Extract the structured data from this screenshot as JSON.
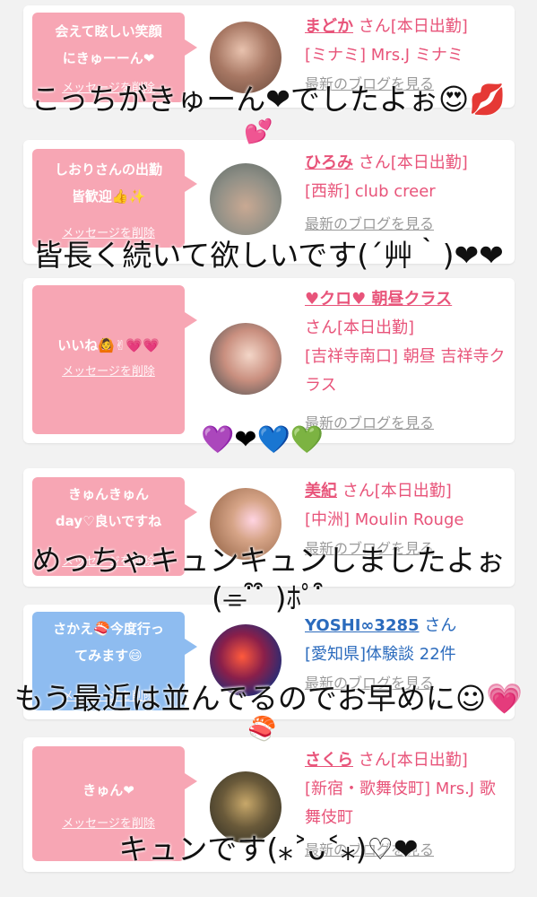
{
  "delete_label": "メッセージを削除",
  "blog_label": "最新のブログを見る",
  "honorific": "さん",
  "cards": [
    {
      "message": "会えて眩しい笑顔\nにきゅーーん❤",
      "name": "まどか",
      "status": "[本日出勤]",
      "shop": "[ミナミ] Mrs.J ミナミ"
    },
    {
      "message": "しおりさんの出勤\n皆歓迎👍✨",
      "name": "ひろみ",
      "status": "[本日出勤]",
      "shop": "[西新] club creer"
    },
    {
      "message": "いいね🙆✌💗💗",
      "name": "♥クロ♥ 朝昼クラス",
      "status": "[本日出勤]",
      "shop": "[吉祥寺南口] 朝昼 吉祥寺クラス"
    },
    {
      "message": "きゅんきゅん\nday♡良いですね",
      "name": "美紀",
      "status": "[本日出勤]",
      "shop": "[中洲] Moulin Rouge"
    },
    {
      "message": "さかえ🍣今度行っ\nてみます😄",
      "name": "YOSHI∞3285",
      "status": "",
      "shop": "[愛知県]体験談 22件"
    },
    {
      "message": "きゅん❤",
      "name": "さくら",
      "status": "[本日出勤]",
      "shop": "[新宿・歌舞伎町] Mrs.J 歌舞伎町"
    }
  ],
  "captions": {
    "c1": "こっちがきゅーん❤でしたよぉ😍💋",
    "c2": "皆長く続いて欲しいです(´艸｀)❤❤",
    "c3": "めっちゃキュンキュンしましたよぉ",
    "c4": "(⌯ ͒ ͒ )ﾎﾟ ͒",
    "c5": "もう最近は並んでるのでお早めに☺💗",
    "c6": "キュンです(⁎˃ᴗ˂⁎)♡❤"
  },
  "stickers": {
    "s1": "💕",
    "s2": "💜❤💙💚",
    "s3": "🍣"
  }
}
